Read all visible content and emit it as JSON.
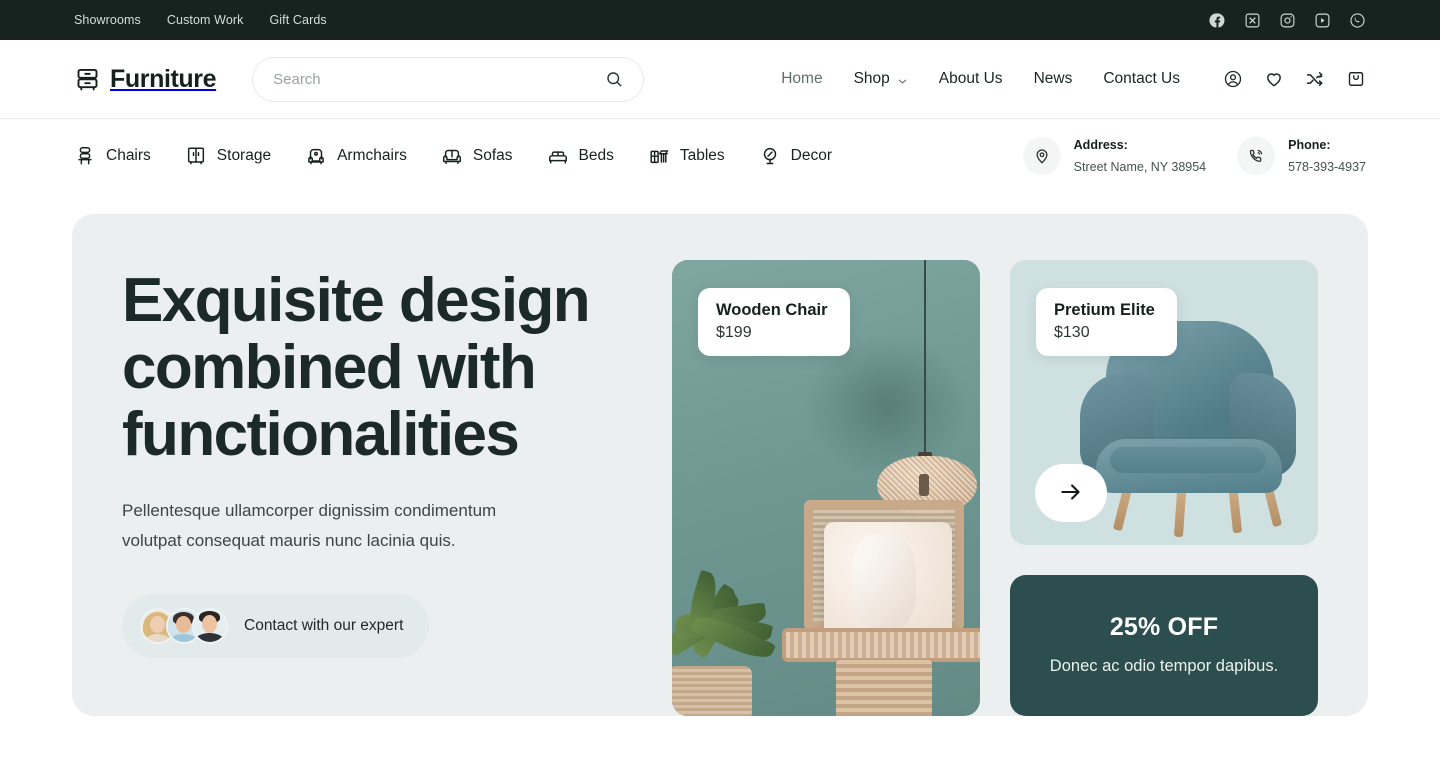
{
  "topbar": {
    "links": [
      {
        "label": "Showrooms"
      },
      {
        "label": "Custom Work"
      },
      {
        "label": "Gift Cards"
      }
    ],
    "social": [
      {
        "name": "facebook-icon"
      },
      {
        "name": "x-twitter-icon"
      },
      {
        "name": "instagram-icon"
      },
      {
        "name": "youtube-icon"
      },
      {
        "name": "whatsapp-icon"
      }
    ],
    "bg_color": "#17231f"
  },
  "header": {
    "logo_text": "Furniture",
    "logo_icon": "dresser-icon",
    "search": {
      "placeholder": "Search",
      "value": "",
      "icon": "search-icon"
    },
    "nav": [
      {
        "label": "Home",
        "active": true,
        "has_caret": false
      },
      {
        "label": "Shop",
        "active": false,
        "has_caret": true
      },
      {
        "label": "About Us",
        "active": false,
        "has_caret": false
      },
      {
        "label": "News",
        "active": false,
        "has_caret": false
      },
      {
        "label": "Contact Us",
        "active": false,
        "has_caret": false
      }
    ],
    "icons": [
      {
        "name": "account-icon"
      },
      {
        "name": "wishlist-heart-icon"
      },
      {
        "name": "compare-shuffle-icon"
      },
      {
        "name": "cart-bag-icon"
      }
    ]
  },
  "categories": [
    {
      "label": "Chairs",
      "icon": "chair-icon"
    },
    {
      "label": "Storage",
      "icon": "cabinet-icon"
    },
    {
      "label": "Armchairs",
      "icon": "armchair-icon"
    },
    {
      "label": "Sofas",
      "icon": "sofa-icon"
    },
    {
      "label": "Beds",
      "icon": "bed-icon"
    },
    {
      "label": "Tables",
      "icon": "table-icon"
    },
    {
      "label": "Decor",
      "icon": "decor-lamp-icon"
    }
  ],
  "contacts": [
    {
      "icon": "location-pin-icon",
      "label": "Address:",
      "value": "Street Name, NY 38954"
    },
    {
      "icon": "phone-icon",
      "label": "Phone:",
      "value": "578-393-4937"
    }
  ],
  "hero": {
    "heading": "Exquisite design combined with functionalities",
    "paragraph": "Pellentesque ullamcorper dignissim condimentum volutpat consequat mauris nunc lacinia quis.",
    "expert_cta": "Contact with our expert",
    "bg_color": "#eceff0",
    "products": [
      {
        "name": "Wooden Chair",
        "price": "$199"
      },
      {
        "name": "Pretium Elite",
        "price": "$130"
      }
    ],
    "next_arrow": "arrow-right-icon",
    "promo": {
      "title": "25% OFF",
      "subtitle": "Donec ac odio tempor dapibus.",
      "bg_color": "#2c4e4e"
    }
  }
}
